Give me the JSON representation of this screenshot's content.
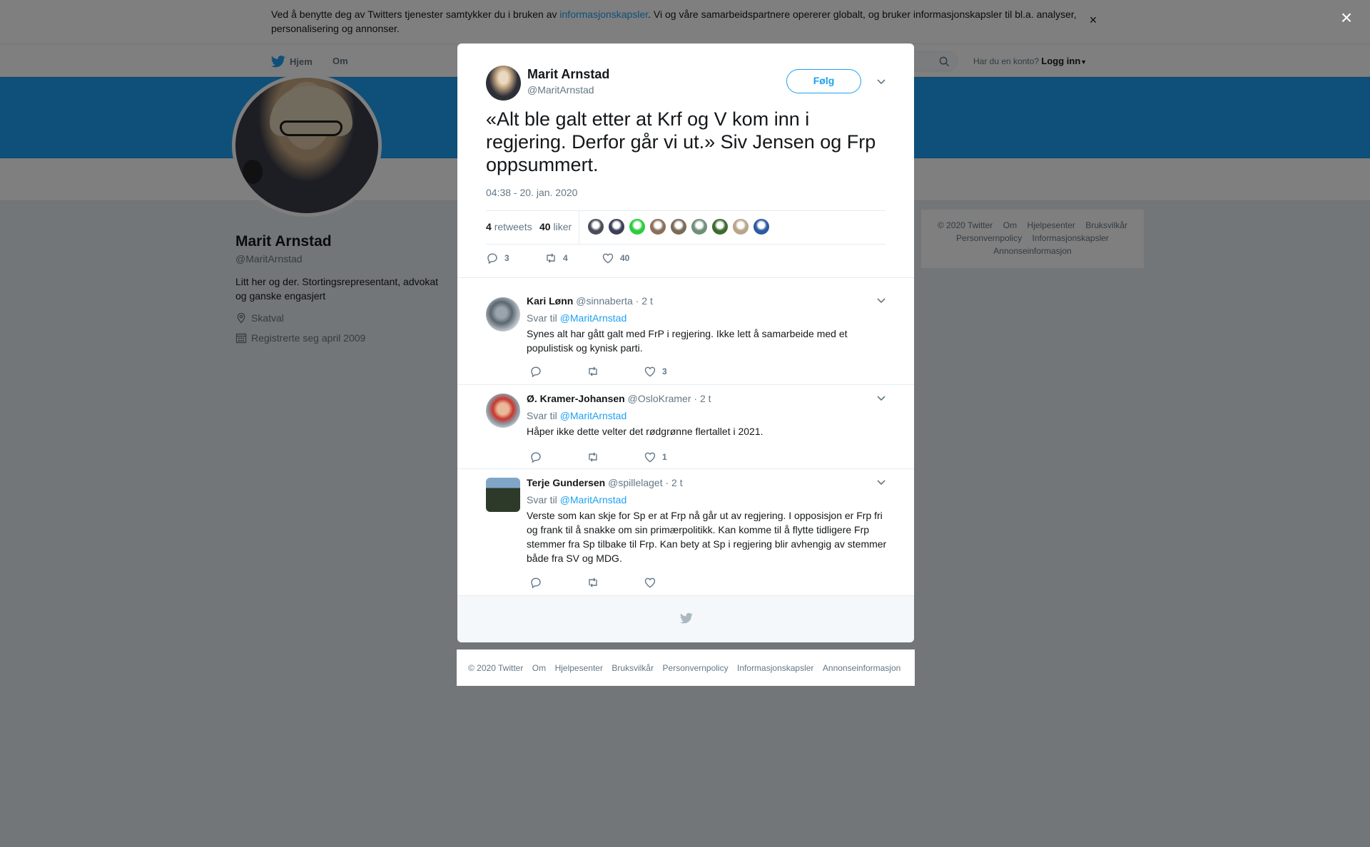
{
  "cookie_banner": {
    "text_before": "Ved å benytte deg av Twitters tjenester samtykker du i bruken av ",
    "link": "informasjonskapsler",
    "text_after": ". Vi og våre samarbeidspartnere opererer globalt, og bruker informasjonskapsler til bl.a. analyser, personalisering og annonser.",
    "close": "×"
  },
  "nav": {
    "home": "Hjem",
    "about": "Om",
    "login_prompt": "Har du en konto?",
    "login_link": "Logg inn"
  },
  "profile": {
    "name": "Marit Arnstad",
    "handle": "@MaritArnstad",
    "bio": "Litt her og der. Stortingsrepresentant, advokat og ganske engasjert",
    "location": "Skatval",
    "joined": "Registrerte seg april 2009"
  },
  "side_footer": [
    "© 2020 Twitter",
    "Om",
    "Hjelpesenter",
    "Bruksvilkår",
    "Personvernpolicy",
    "Informasjonskapsler",
    "Annonseinformasjon"
  ],
  "modal_close": "×",
  "tweet": {
    "name": "Marit Arnstad",
    "handle": "@MaritArnstad",
    "follow": "Følg",
    "text": "«Alt ble galt etter at Krf og V kom inn i regjering. Derfor går vi ut.» Siv Jensen og Frp oppsummert.",
    "time": "04:38 - 20. jan. 2020",
    "retweets_count": "4",
    "retweets_label": "retweets",
    "likes_count": "40",
    "likes_label": "liker",
    "reply_count": "3",
    "retweet_count": "4",
    "like_count": "40",
    "liker_colors": [
      "#4a4f57",
      "#3d3f5a",
      "#2ecc40",
      "#8b6f5a",
      "#7a6a58",
      "#6f8f7a",
      "#3e6b2f",
      "#b8a48a",
      "#2c5aa0"
    ]
  },
  "replies": [
    {
      "name": "Kari Lønn",
      "handle": "@sinnaberta",
      "time": "· 2 t",
      "reply_to_label": "Svar til",
      "reply_to": "@MaritArnstad",
      "text": "Synes alt har gått galt med FrP i regjering. Ikke lett å samarbeide med et populistisk og kynisk parti.",
      "reply_count": "",
      "retweet_count": "",
      "like_count": "3"
    },
    {
      "name": "Ø. Kramer-Johansen",
      "handle": "@OsloKramer",
      "time": "· 2 t",
      "reply_to_label": "Svar til",
      "reply_to": "@MaritArnstad",
      "text": "Håper ikke dette velter det rødgrønne flertallet i 2021.",
      "reply_count": "",
      "retweet_count": "",
      "like_count": "1"
    },
    {
      "name": "Terje Gundersen",
      "handle": "@spillelaget",
      "time": "· 2 t",
      "reply_to_label": "Svar til",
      "reply_to": "@MaritArnstad",
      "text": "Verste som kan skje for Sp er at Frp nå går ut av regjering. I opposisjon er Frp fri og frank til å snakke om sin primærpolitikk. Kan komme til å flytte tidligere Frp stemmer fra Sp tilbake til Frp. Kan bety at Sp i regjering blir avhengig av stemmer både fra SV og MDG.",
      "reply_count": "",
      "retweet_count": "",
      "like_count": ""
    }
  ],
  "bottom_footer": [
    "© 2020 Twitter",
    "Om",
    "Hjelpesenter",
    "Bruksvilkår",
    "Personvernpolicy",
    "Informasjonskapsler",
    "Annonseinformasjon"
  ],
  "icons": {
    "twitter_bird": "twitter-bird-icon",
    "search": "search-icon",
    "location": "location-pin-icon",
    "calendar": "calendar-icon",
    "reply": "reply-icon",
    "retweet": "retweet-icon",
    "like": "heart-icon",
    "chevron": "chevron-down-icon"
  },
  "colors": {
    "accent": "#1da1f2",
    "banner": "#1da1f2",
    "text_secondary": "#657786"
  }
}
